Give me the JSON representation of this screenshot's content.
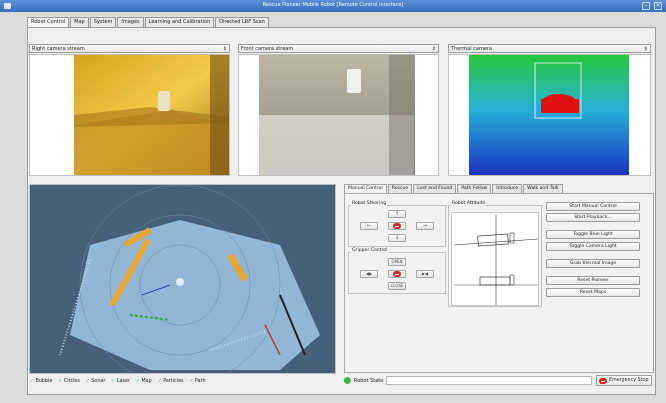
{
  "window": {
    "title": "Rescue Pioneer Mobile Robot [Remote Control Interface]"
  },
  "tabs": [
    {
      "label": "Robot Control",
      "active": true
    },
    {
      "label": "Map",
      "active": false
    },
    {
      "label": "System",
      "active": false
    },
    {
      "label": "Images",
      "active": false
    },
    {
      "label": "Learning and Calibration",
      "active": false
    },
    {
      "label": "Directed LRF Scan",
      "active": false
    }
  ],
  "cameras": {
    "left_select": "Right camera stream",
    "center_select": "Front camera stream",
    "right_select": "Thermal camera"
  },
  "subtabs": [
    {
      "label": "Manual Control",
      "active": true
    },
    {
      "label": "Rescue",
      "active": false
    },
    {
      "label": "Lost and Found",
      "active": false
    },
    {
      "label": "Path Follow",
      "active": false
    },
    {
      "label": "Introduce",
      "active": false
    },
    {
      "label": "Walk and Talk",
      "active": false
    }
  ],
  "manual": {
    "steering_label": "Robot Steering",
    "gripper_label": "Gripper Control",
    "attitude_label": "Robot Attitude",
    "up_glyph": "↑",
    "down_glyph": "↓",
    "left_glyph": "←",
    "right_glyph": "→",
    "gripper_open": "OPEN",
    "gripper_close": "CLOSE",
    "gripper_in_glyph": "◀▶",
    "gripper_out_glyph": "▶◀"
  },
  "actions": {
    "start_manual": "Start Manual Control",
    "start_playback": "Start Playback...",
    "toggle_blue": "Toggle Blue Light",
    "toggle_camera": "Toggle Camera Light",
    "grab_thermal": "Grab thermal image",
    "reset_pioneer": "Reset Pioneer",
    "reset_maps": "Reset Maps"
  },
  "legend": [
    {
      "label": "Bubble",
      "checked": true
    },
    {
      "label": "Circles",
      "checked": true
    },
    {
      "label": "Sonar",
      "checked": true
    },
    {
      "label": "Laser",
      "checked": true
    },
    {
      "label": "Map",
      "checked": true
    },
    {
      "label": "Particles",
      "checked": true
    },
    {
      "label": "Path",
      "checked": true
    }
  ],
  "status": {
    "robot_state_label": "Robot State",
    "robot_state_value": "",
    "emergency_stop": "Emergency Stop"
  },
  "colors": {
    "map_bg": "#45607a",
    "map_floor": "#9fc6e6",
    "wall": "#e8a531",
    "status_ok": "#3cb64b",
    "stop_red": "#d3241c"
  }
}
